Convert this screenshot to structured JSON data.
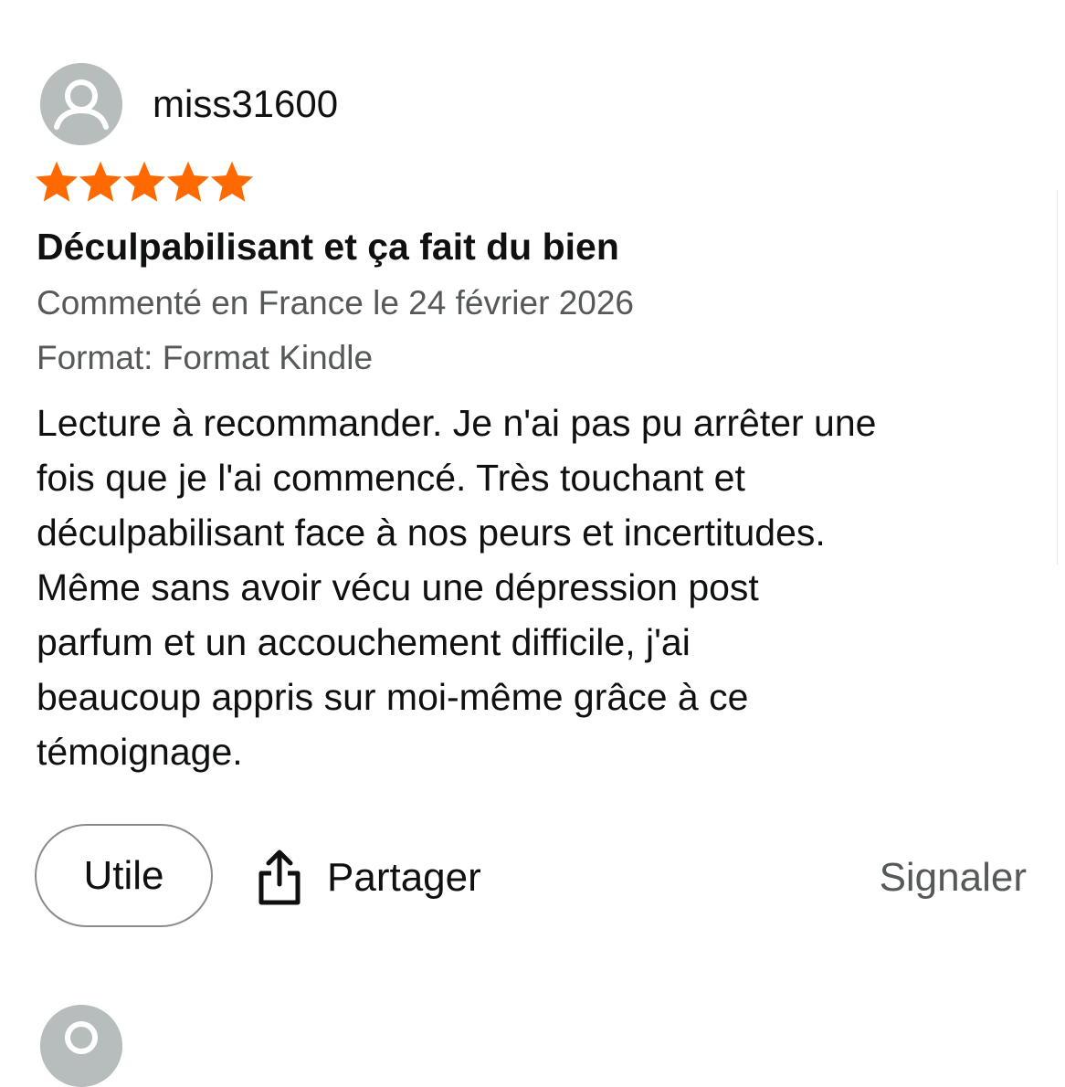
{
  "review": {
    "username": "miss31600",
    "rating": 5,
    "rating_max": 5,
    "star_color": "#ff6a00",
    "title": "Déculpabilisant et ça fait du bien",
    "date_line": "Commenté en France le 24 février 2026",
    "format_line": "Format: Format Kindle",
    "body_lines": [
      "Lecture à recommander. Je n'ai pas pu arrêter une",
      "fois que je l'ai commencé. Très touchant et",
      "déculpabilisant face à nos peurs et incertitudes.",
      "Même sans avoir vécu une dépression post",
      "parfum et un accouchement difficile, j'ai",
      "beaucoup appris sur moi-même grâce à ce",
      "témoignage."
    ]
  },
  "actions": {
    "useful_label": "Utile",
    "share_label": "Partager",
    "report_label": "Signaler"
  },
  "icons": {
    "avatar": "default-user-icon",
    "star": "star-icon",
    "share": "share-icon"
  }
}
